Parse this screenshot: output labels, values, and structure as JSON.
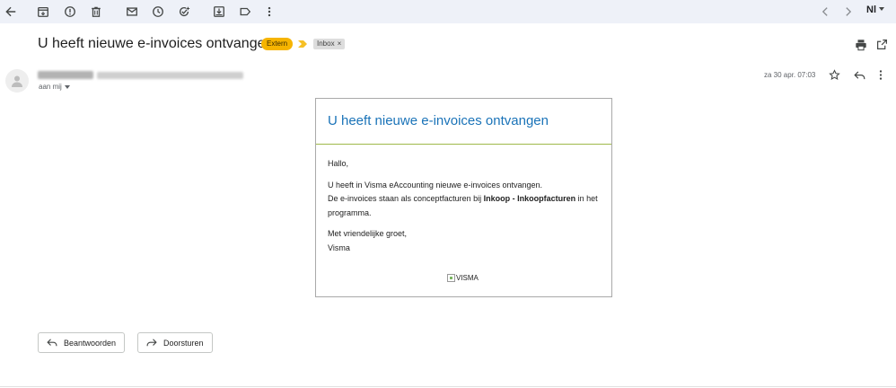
{
  "message": {
    "subject": "U heeft nieuwe e-invoices ontvangen",
    "labels": {
      "external": "Extern",
      "inbox": "Inbox",
      "inbox_remove": "×"
    },
    "to_me": "aan mij",
    "date": "za 30 apr. 07:03"
  },
  "toolbar": {
    "language": "Nl"
  },
  "email": {
    "title": "U heeft nieuwe e-invoices ontvangen",
    "greeting": "Hallo,",
    "line1": "U heeft in Visma eAccounting nieuwe e-invoices ontvangen.",
    "line2_pre": "De e-invoices staan als conceptfacturen bij ",
    "line2_bold": "Inkoop - Inkoopfacturen",
    "line2_post": " in het programma.",
    "closing": "Met vriendelijke groet,",
    "signature": "Visma",
    "logo_alt": "VISMA"
  },
  "actions": {
    "reply": "Beantwoorden",
    "forward": "Doorsturen"
  },
  "colors": {
    "toolbar_bg": "#eef1f8",
    "extern_label": "#f6b400",
    "email_title": "#1a73b8",
    "divider": "#9fb84a"
  }
}
